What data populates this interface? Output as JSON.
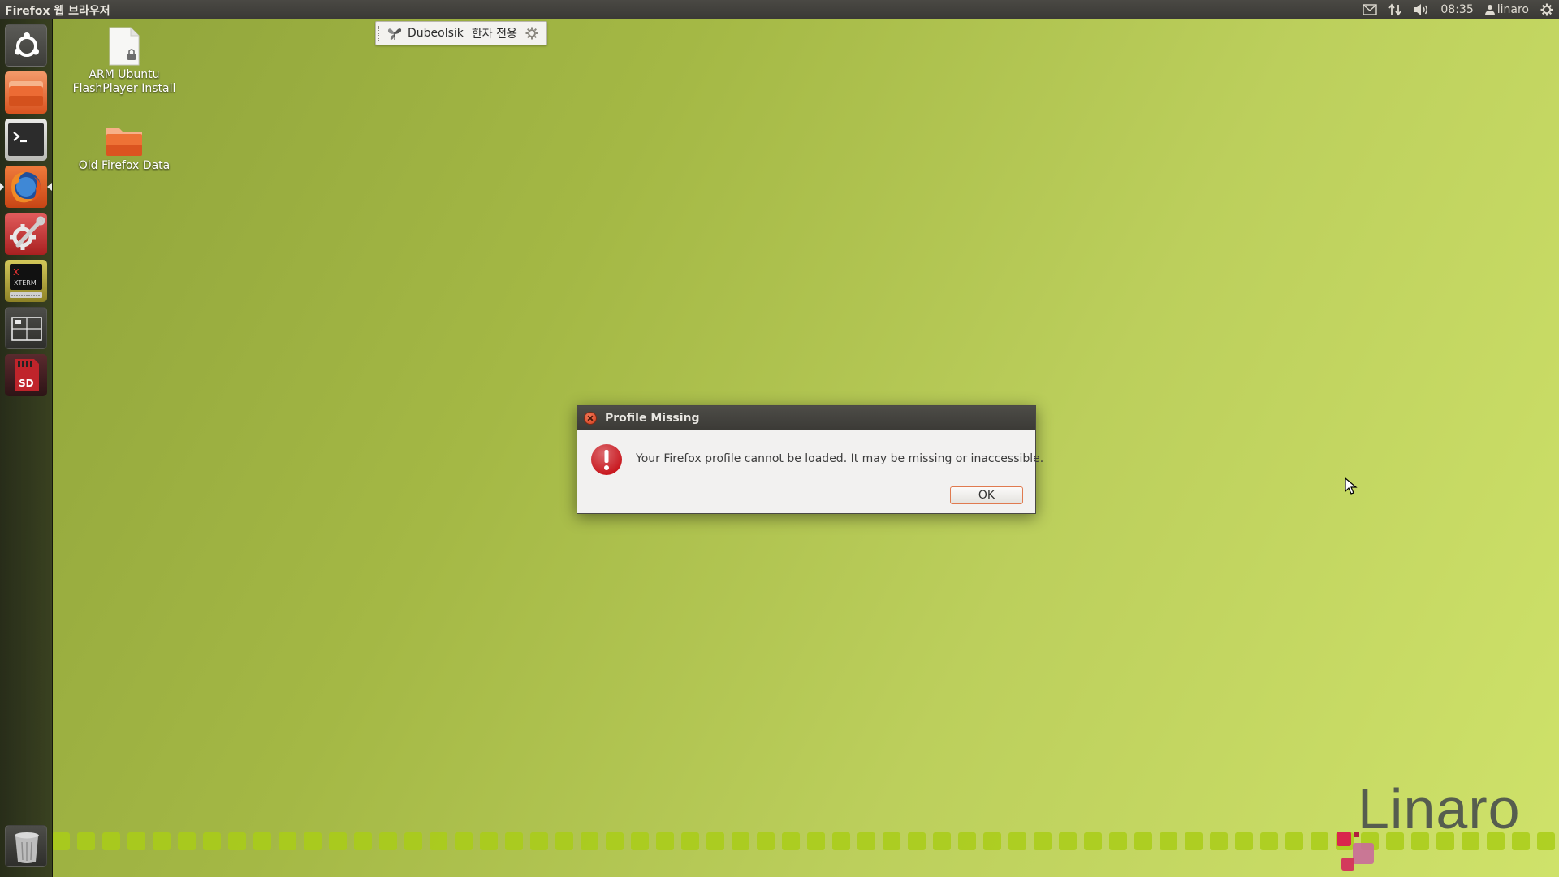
{
  "panel": {
    "app_title": "Firefox 웹 브라우저",
    "clock": "08:35",
    "user": "linaro"
  },
  "launcher": {
    "items": [
      {
        "name": "dash-home",
        "icon": "ubuntu-logo-icon"
      },
      {
        "name": "files",
        "icon": "folder-icon"
      },
      {
        "name": "terminal",
        "icon": "terminal-icon"
      },
      {
        "name": "firefox",
        "icon": "firefox-icon"
      },
      {
        "name": "system-settings",
        "icon": "settings-tools-icon"
      },
      {
        "name": "xterm",
        "icon": "xterm-icon",
        "label": "XTERM"
      },
      {
        "name": "workspace-switcher",
        "icon": "workspace-icon"
      },
      {
        "name": "sd-card",
        "icon": "sd-card-icon",
        "label": "SD"
      },
      {
        "name": "trash",
        "icon": "trash-icon"
      }
    ]
  },
  "desktop_icons": [
    {
      "label_line1": "ARM Ubuntu",
      "label_line2": "FlashPlayer Install",
      "icon": "locked-file-icon"
    },
    {
      "label_line1": "Old Firefox Data",
      "icon": "folder-icon"
    }
  ],
  "ime_toolbar": {
    "layout": "Dubeolsik",
    "mode": "한자 전용"
  },
  "dialog": {
    "title": "Profile Missing",
    "message": "Your Firefox profile cannot be loaded. It may be missing or inaccessible.",
    "ok_label": "OK"
  },
  "branding": {
    "logo_text": "Linaro"
  },
  "colors": {
    "accent_orange": "#e07a4f",
    "error_red": "#c8161d",
    "panel_dark": "#3c3b37"
  }
}
